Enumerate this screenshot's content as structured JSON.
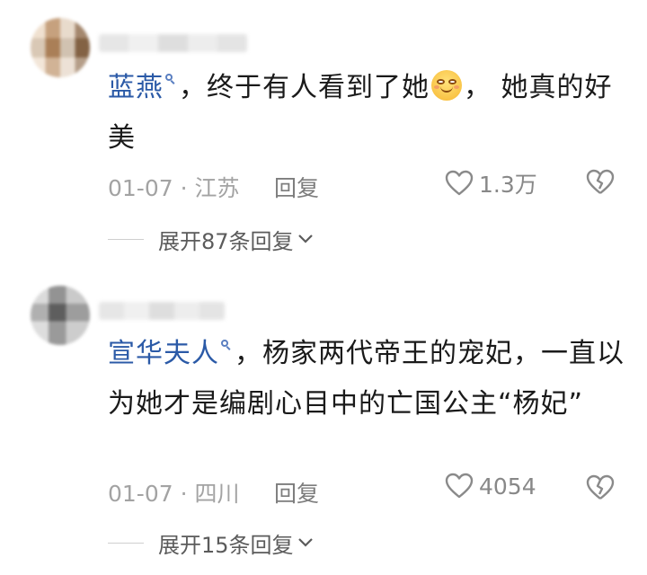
{
  "comments": [
    {
      "username": "蓝燕",
      "text_before_emoji": "，终于有人看到了她",
      "text_after_emoji": "，  她真的好美",
      "date_location": "01-07 · 江苏",
      "reply_label": "回复",
      "like_count": "1.3万",
      "expand_label": "展开87条回复"
    },
    {
      "username": "宣华夫人",
      "text": "，杨家两代帝王的宠妃，一直以为她才是编剧心目中的亡国公主“杨妃”",
      "date_location": "01-07 · 四川",
      "reply_label": "回复",
      "like_count": "4054",
      "expand_label": "展开15条回复"
    }
  ],
  "colors": {
    "username": "#2b5aa7",
    "meta": "#a3a3a3"
  },
  "icons": [
    "search-icon",
    "emoji-icon",
    "heart-icon",
    "broken-heart-icon",
    "chevron-down-icon"
  ]
}
